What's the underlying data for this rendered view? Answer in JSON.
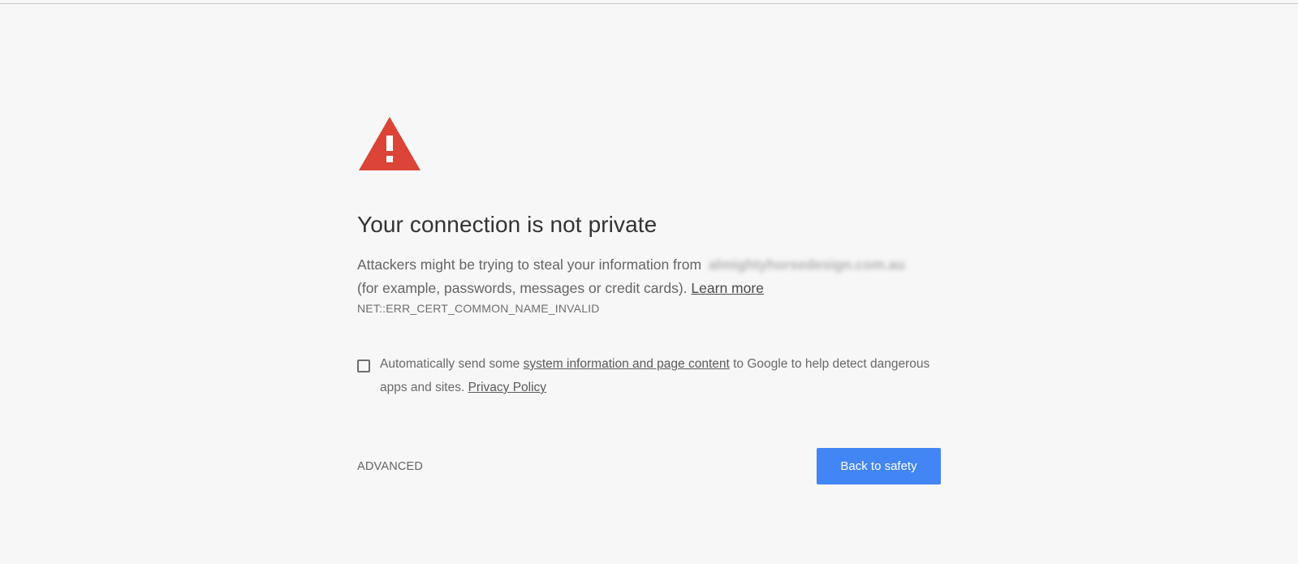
{
  "interstitial": {
    "title": "Your connection is not private",
    "description_pre": "Attackers might be trying to steal your information from",
    "domain": "almightyhorsedesign.com.au",
    "description_post": "(for example, passwords, messages or credit cards).",
    "learn_more": "Learn more",
    "error_code": "NET::ERR_CERT_COMMON_NAME_INVALID",
    "extended_reporting": {
      "checked": false,
      "text_pre": "Automatically send some",
      "link_label": "system information and page content",
      "text_mid": "to Google to help detect dangerous apps and sites.",
      "privacy_label": "Privacy Policy"
    },
    "advanced_label": "ADVANCED",
    "back_label": "Back to safety"
  },
  "colors": {
    "background": "#f7f7f7",
    "warning": "#db4437",
    "primary_button": "#4285f4"
  },
  "icons": {
    "warning": "warning-triangle-icon"
  }
}
